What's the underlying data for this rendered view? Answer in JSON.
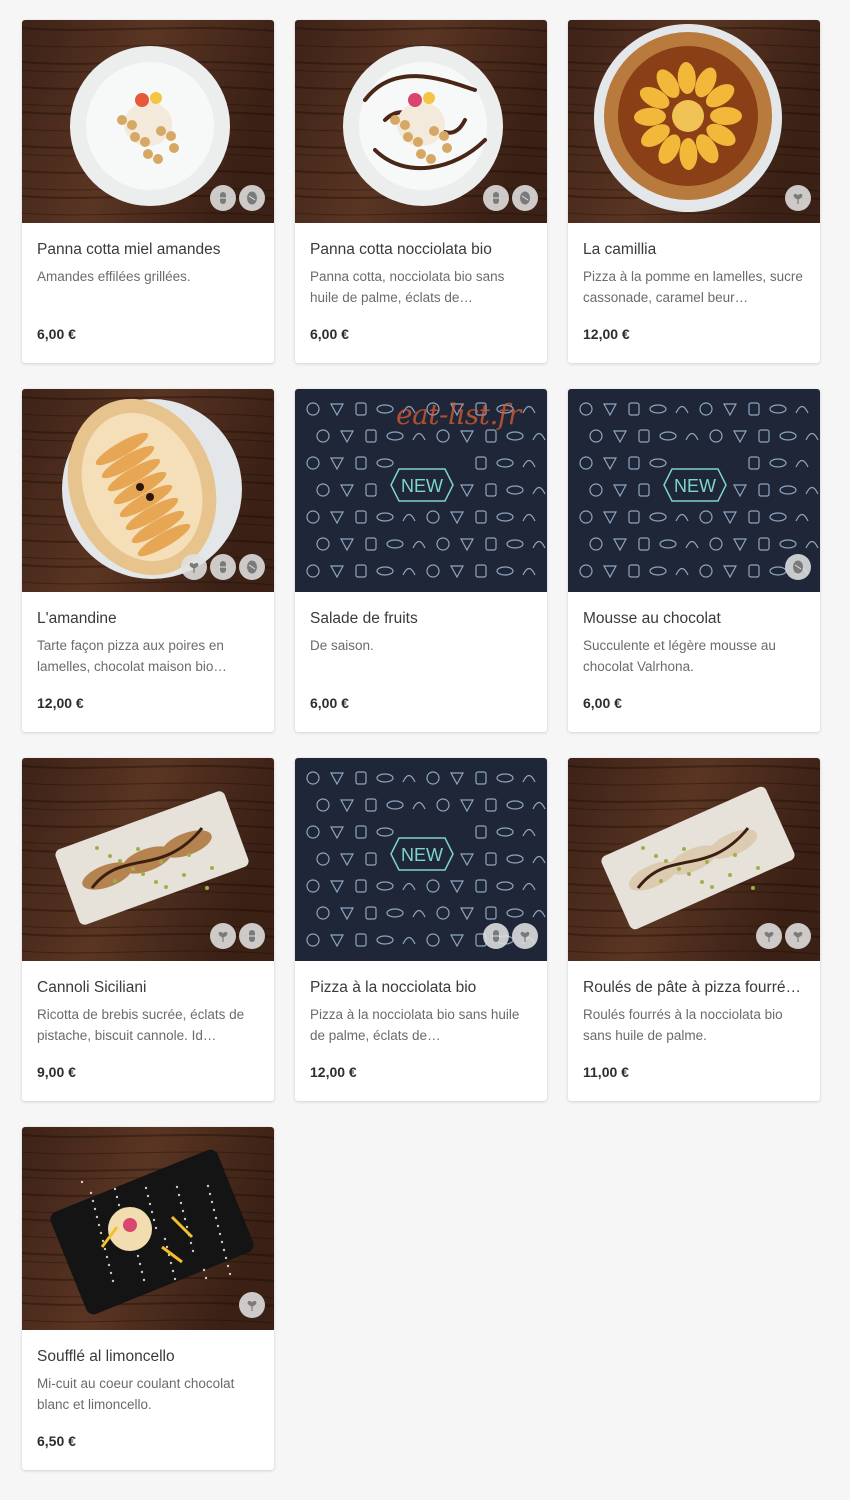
{
  "watermark": "eat-list.fr",
  "placeholder_text": "NEW",
  "colors": {
    "card_bg": "#ffffff",
    "page_bg": "#f6f6f6",
    "placeholder_bg": "#1e2638",
    "placeholder_line": "#8fa6c0",
    "new_accent": "#7fd4d0",
    "wood": "#4a2a1b"
  },
  "items": [
    {
      "name": "Panna cotta miel amandes",
      "description": "Amandes effilées grillées.",
      "price": "6,00 €",
      "image": "panna-cotta-plate",
      "badges": [
        "gluten-free-icon",
        "lactose-free-icon"
      ]
    },
    {
      "name": "Panna cotta nocciolata bio",
      "description": "Panna cotta, nocciolata bio sans huile de palme, éclats de…",
      "price": "6,00 €",
      "image": "panna-cotta-chocolate-plate",
      "badges": [
        "gluten-free-icon",
        "lactose-free-icon"
      ]
    },
    {
      "name": "La camillia",
      "description": "Pizza à la pomme en lamelles, sucre cassonade, caramel beur…",
      "price": "12,00 €",
      "image": "apple-pizza",
      "badges": [
        "vegetarian-icon"
      ]
    },
    {
      "name": "L'amandine",
      "description": "Tarte façon pizza aux poires en lamelles, chocolat maison bio…",
      "price": "12,00 €",
      "image": "pear-pizza",
      "badges": [
        "vegetarian-icon",
        "gluten-free-icon",
        "lactose-free-icon"
      ]
    },
    {
      "name": "Salade de fruits",
      "description": "De saison.",
      "price": "6,00 €",
      "image": "new-placeholder",
      "badges": []
    },
    {
      "name": "Mousse au chocolat",
      "description": "Succulente et légère mousse au chocolat Valrhona.",
      "price": "6,00 €",
      "image": "new-placeholder",
      "badges": [
        "lactose-free-icon"
      ]
    },
    {
      "name": "Cannoli Siciliani",
      "description": "Ricotta de brebis sucrée, éclats de pistache, biscuit cannole. Id…",
      "price": "9,00 €",
      "image": "cannoli-tray",
      "badges": [
        "vegetarian-icon",
        "gluten-free-icon"
      ]
    },
    {
      "name": "Pizza à la nocciolata bio",
      "description": "Pizza à la nocciolata bio sans huile de palme, éclats de…",
      "price": "12,00 €",
      "image": "new-placeholder",
      "badges": [
        "gluten-free-icon",
        "vegetarian-icon"
      ]
    },
    {
      "name": "Roulés de pâte à pizza fourrés à la nocciolata bio",
      "description": "Roulés fourrés à la nocciolata bio sans huile de palme.",
      "price": "11,00 €",
      "image": "pizza-rolls-tray",
      "badges": [
        "vegetarian-icon",
        "vegetarian-icon"
      ]
    },
    {
      "name": "Soufflé al limoncello",
      "description": "Mi-cuit au coeur coulant chocolat blanc et limoncello.",
      "price": "6,50 €",
      "image": "souffle-black-plate",
      "badges": [
        "vegetarian-icon"
      ]
    }
  ]
}
